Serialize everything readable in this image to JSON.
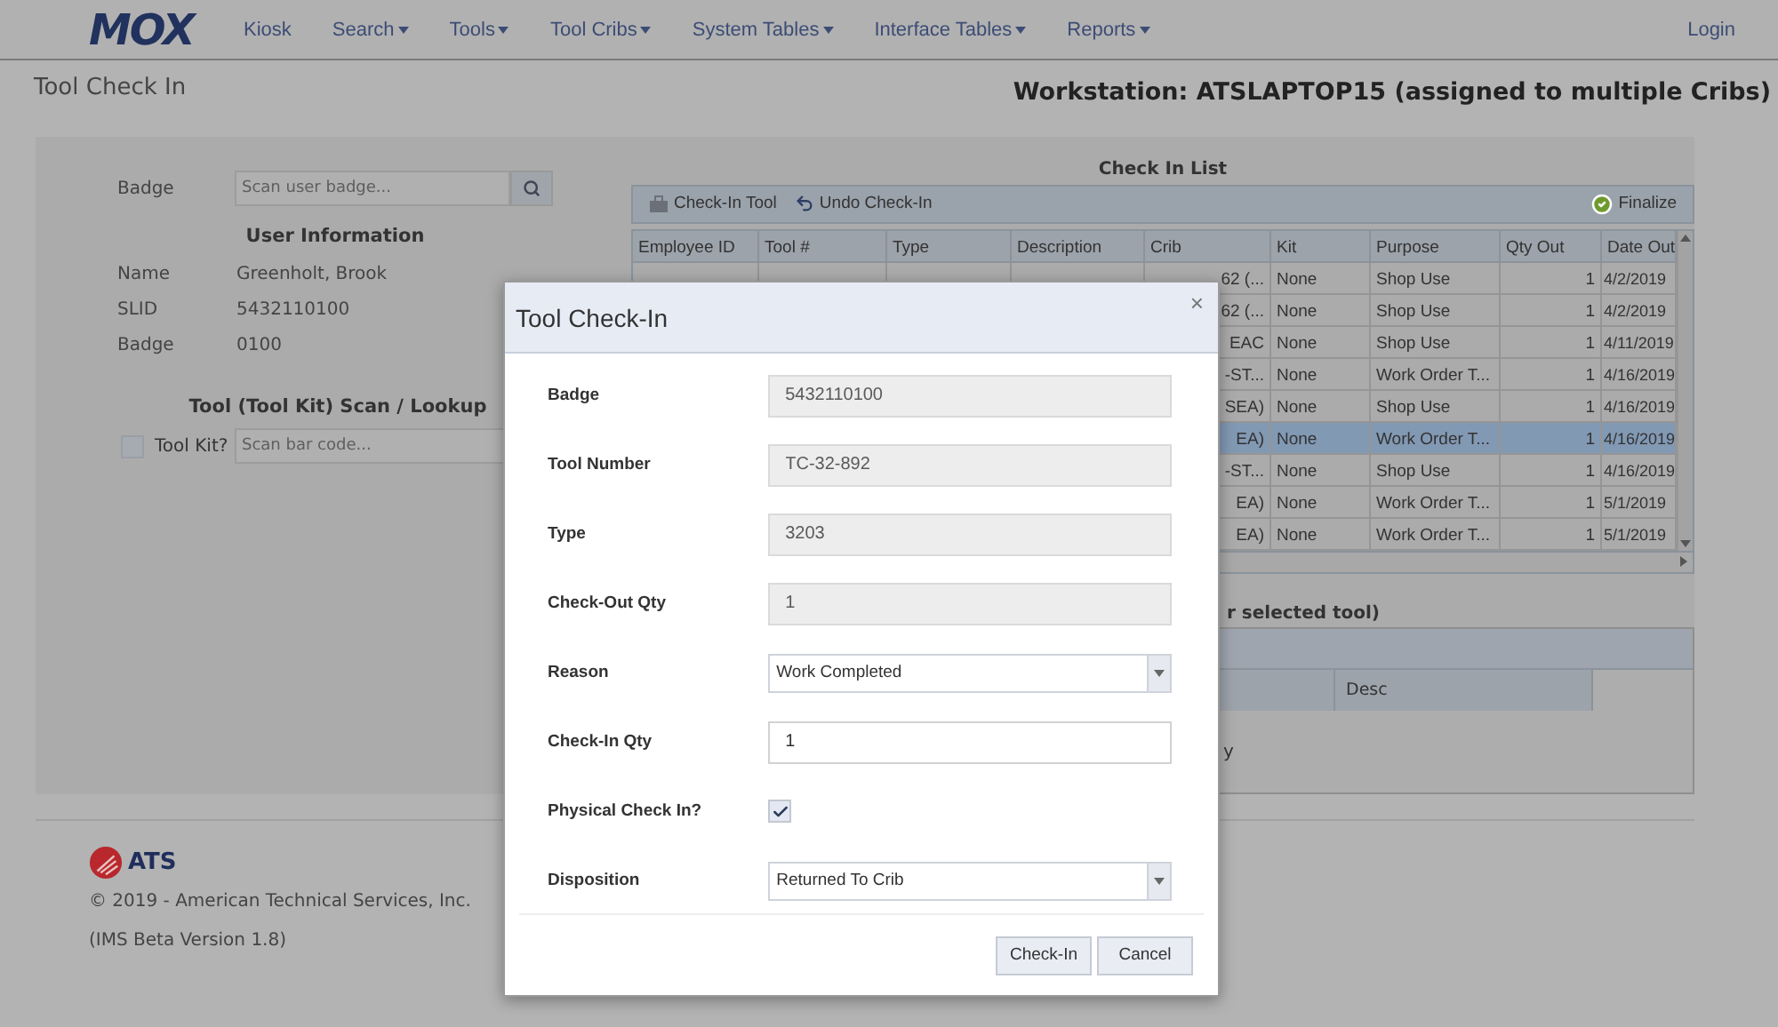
{
  "nav": {
    "logo": "MOX",
    "items": [
      {
        "label": "Kiosk",
        "dropdown": false
      },
      {
        "label": "Search",
        "dropdown": true
      },
      {
        "label": "Tools",
        "dropdown": true
      },
      {
        "label": "Tool Cribs",
        "dropdown": true
      },
      {
        "label": "System Tables",
        "dropdown": true
      },
      {
        "label": "Interface Tables",
        "dropdown": true
      },
      {
        "label": "Reports",
        "dropdown": true
      }
    ],
    "login": "Login"
  },
  "page_title": "Tool Check In",
  "workstation": "Workstation: ATSLAPTOP15 (assigned to multiple Cribs)",
  "badge_lookup": {
    "label": "Badge",
    "placeholder": "Scan user badge..."
  },
  "user_info": {
    "title": "User Information",
    "fields": [
      {
        "label": "Name",
        "value": "Greenholt, Brook"
      },
      {
        "label": "SLID",
        "value": "5432110100"
      },
      {
        "label": "Badge",
        "value": "0100"
      }
    ]
  },
  "tool_lookup": {
    "title": "Tool (Tool Kit) Scan / Lookup",
    "kit_label": "Tool Kit?",
    "kit_checked": false,
    "placeholder": "Scan bar code..."
  },
  "check_in_list": {
    "title": "Check In List",
    "toolbar": [
      {
        "label": "Check-In Tool",
        "kind": "tool"
      },
      {
        "label": "Undo Check-In",
        "kind": "undo"
      },
      {
        "label": "Finalize",
        "kind": "finalize"
      }
    ],
    "columns": [
      "Employee ID",
      "Tool #",
      "Type",
      "Description",
      "Crib",
      "Kit",
      "Purpose",
      "Qty Out",
      "Date Out"
    ],
    "rows": [
      {
        "crib": "62 (...",
        "kit": "None",
        "purpose": "Shop Use",
        "qty_out": "1",
        "date_out": "4/2/2019",
        "selected": false
      },
      {
        "crib": "62 (...",
        "kit": "None",
        "purpose": "Shop Use",
        "qty_out": "1",
        "date_out": "4/2/2019",
        "selected": false
      },
      {
        "crib": "EAC",
        "kit": "None",
        "purpose": "Shop Use",
        "qty_out": "1",
        "date_out": "4/11/2019",
        "selected": false
      },
      {
        "crib": "-ST...",
        "kit": "None",
        "purpose": "Work Order T...",
        "qty_out": "1",
        "date_out": "4/16/2019",
        "selected": false
      },
      {
        "crib": "SEA)",
        "kit": "None",
        "purpose": "Shop Use",
        "qty_out": "1",
        "date_out": "4/16/2019",
        "selected": false
      },
      {
        "crib": "EA)",
        "kit": "None",
        "purpose": "Work Order T...",
        "qty_out": "1",
        "date_out": "4/16/2019",
        "selected": true
      },
      {
        "crib": "-ST...",
        "kit": "None",
        "purpose": "Shop Use",
        "qty_out": "1",
        "date_out": "4/16/2019",
        "selected": false
      },
      {
        "crib": "EA)",
        "kit": "None",
        "purpose": "Work Order T...",
        "qty_out": "1",
        "date_out": "5/1/2019",
        "selected": false
      },
      {
        "crib": "EA)",
        "kit": "None",
        "purpose": "Work Order T...",
        "qty_out": "1",
        "date_out": "5/1/2019",
        "selected": false
      }
    ]
  },
  "details": {
    "title_fragment": "r selected tool)",
    "columns": [
      "Desc"
    ],
    "text_fragment": "y"
  },
  "footer": {
    "brand": "ATS",
    "copyright": "© 2019 - American Technical Services, Inc.",
    "version": "(IMS Beta Version 1.8)"
  },
  "dialog": {
    "title": "Tool Check-In",
    "close": "×",
    "fields": [
      {
        "label": "Badge",
        "kind": "readonly",
        "value": "5432110100"
      },
      {
        "label": "Tool Number",
        "kind": "readonly",
        "value": "TC-32-892"
      },
      {
        "label": "Type",
        "kind": "readonly",
        "value": "3203"
      },
      {
        "label": "Check-Out Qty",
        "kind": "readonly",
        "value": "1"
      },
      {
        "label": "Reason",
        "kind": "select",
        "value": "Work Completed"
      },
      {
        "label": "Check-In Qty",
        "kind": "input",
        "value": "1"
      },
      {
        "label": "Physical Check In?",
        "kind": "checkbox",
        "checked": true
      },
      {
        "label": "Disposition",
        "kind": "select",
        "value": "Returned To Crib"
      }
    ],
    "buttons": [
      "Check-In",
      "Cancel"
    ]
  }
}
